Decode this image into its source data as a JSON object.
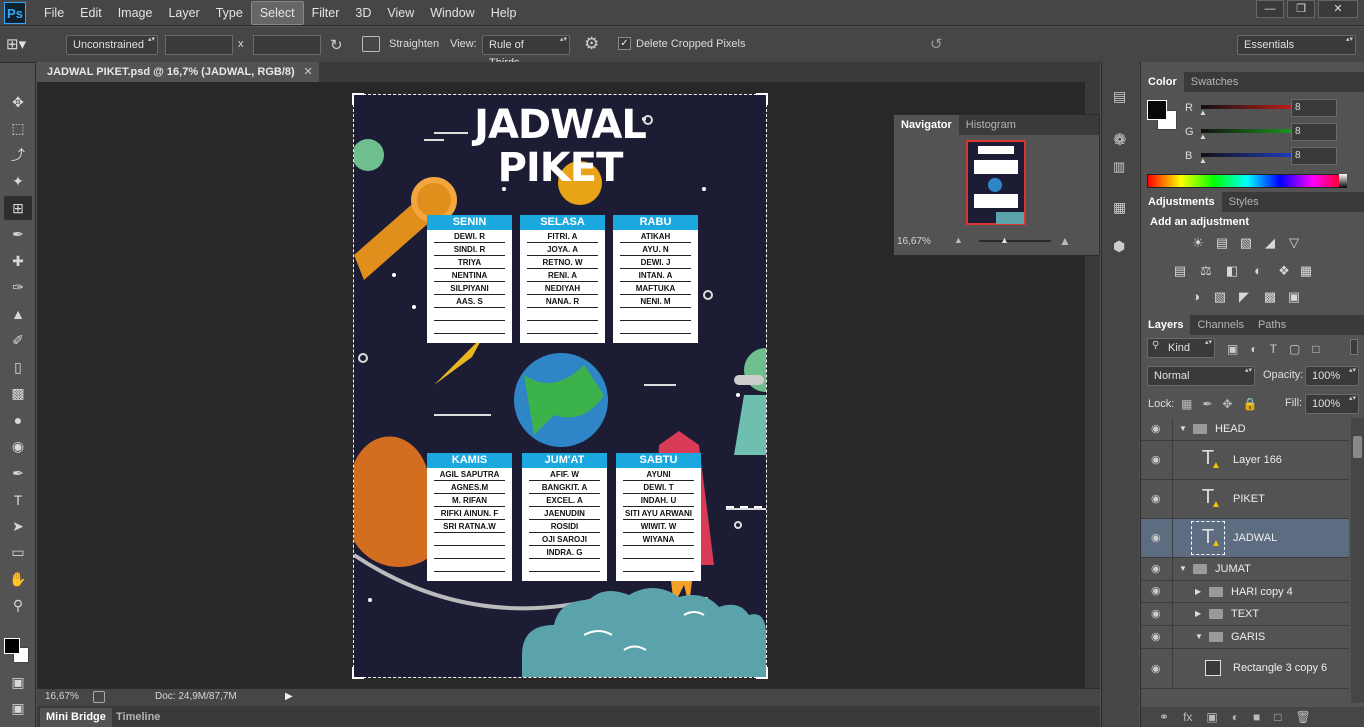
{
  "app": {
    "logo": "Ps",
    "menu": [
      "File",
      "Edit",
      "Image",
      "Layer",
      "Type",
      "Select",
      "Filter",
      "3D",
      "View",
      "Window",
      "Help"
    ],
    "active_menu": "Select",
    "window_controls": [
      "minimize-icon",
      "restore-icon",
      "close-icon"
    ]
  },
  "options": {
    "ratio": "Unconstrained",
    "x_sep": "x",
    "straighten": "Straighten",
    "view_label": "View:",
    "view_value": "Rule of Thirds",
    "delete_cropped": "Delete Cropped Pixels",
    "delete_cropped_checked": true,
    "workspace": "Essentials"
  },
  "document": {
    "tab": "JADWAL PIKET.psd @ 16,7% (JADWAL, RGB/8)",
    "title_line1": "JADWAL",
    "title_line2": "PIKET",
    "cards_top": [
      {
        "day": "SENIN",
        "names": [
          "DEWI. R",
          "SINDI. R",
          "TRIYA",
          "NENTINA",
          "SILPIYANI",
          "AAS. S",
          "",
          ""
        ]
      },
      {
        "day": "SELASA",
        "names": [
          "FITRI. A",
          "JOYA. A",
          "RETNO. W",
          "RENI. A",
          "NEDIYAH",
          "NANA. R",
          "",
          ""
        ]
      },
      {
        "day": "RABU",
        "names": [
          "ATIKAH",
          "AYU. N",
          "DEWI. J",
          "INTAN. A",
          "MAFTUKA",
          "NENI. M",
          "",
          ""
        ]
      }
    ],
    "cards_bottom": [
      {
        "day": "KAMIS",
        "names": [
          "AGIL SAPUTRA",
          "AGNES.M",
          "M. RIFAN",
          "RIFKI AINUN. F",
          "SRI RATNA.W",
          "",
          "",
          ""
        ]
      },
      {
        "day": "JUM'AT",
        "names": [
          "AFIF. W",
          "BANGKIT. A",
          "EXCEL. A",
          "JAENUDIN",
          "ROSIDI",
          "OJI SAROJI",
          "INDRA. G",
          ""
        ]
      },
      {
        "day": "SABTU",
        "names": [
          "AYUNI",
          "DEWI. T",
          "INDAH. U",
          "SITI AYU ARWANI",
          "WIWIT. W",
          "WIYANA",
          "",
          ""
        ]
      }
    ]
  },
  "status": {
    "zoom": "16,67%",
    "doc": "Doc: 24,9M/87,7M"
  },
  "bottom_tabs": [
    "Mini Bridge",
    "Timeline"
  ],
  "navigator": {
    "tabs": [
      "Navigator",
      "Histogram"
    ],
    "zoom": "16,67%"
  },
  "color": {
    "tabs": [
      "Color",
      "Swatches"
    ],
    "channels": [
      {
        "label": "R",
        "value": "8",
        "color": "#cc1f1f"
      },
      {
        "label": "G",
        "value": "8",
        "color": "#1fa31f"
      },
      {
        "label": "B",
        "value": "8",
        "color": "#1f3fcc"
      }
    ]
  },
  "adjustments": {
    "tabs": [
      "Adjustments",
      "Styles"
    ],
    "heading": "Add an adjustment"
  },
  "layers": {
    "tabs": [
      "Layers",
      "Channels",
      "Paths"
    ],
    "kind": "Kind",
    "blend": "Normal",
    "opacity_label": "Opacity:",
    "opacity": "100%",
    "lock_label": "Lock:",
    "fill_label": "Fill:",
    "fill": "100%",
    "rows": [
      {
        "name": "HEAD",
        "type": "group",
        "open": true,
        "indent": 0
      },
      {
        "name": "Layer 166",
        "type": "text",
        "indent": 1
      },
      {
        "name": "PIKET",
        "type": "text",
        "indent": 1
      },
      {
        "name": "JADWAL",
        "type": "text",
        "indent": 1,
        "selected": true
      },
      {
        "name": "JUMAT",
        "type": "group",
        "open": true,
        "indent": 0
      },
      {
        "name": "HARI copy 4",
        "type": "group",
        "open": false,
        "indent": 1
      },
      {
        "name": "TEXT",
        "type": "group",
        "open": false,
        "indent": 1
      },
      {
        "name": "GARIS",
        "type": "group",
        "open": true,
        "indent": 1
      },
      {
        "name": "Rectangle 3 copy 6",
        "type": "shape",
        "indent": 2
      }
    ]
  }
}
